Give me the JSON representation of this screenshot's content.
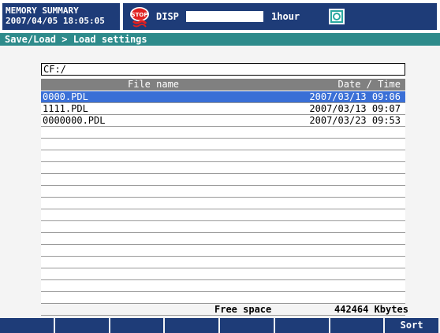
{
  "header": {
    "mode_line1": "MEMORY SUMMARY",
    "mode_line2": "2007/04/05 18:05:05",
    "disp_label": "DISP",
    "time_span": "1hour",
    "stop_icon": "stop-icon",
    "memory_icon": "memory-card-icon"
  },
  "breadcrumb": "Save/Load > Load settings",
  "file_browser": {
    "path": "CF:/",
    "columns": {
      "file_name": "File name",
      "date_time": "Date / Time"
    },
    "rows": [
      {
        "name": "0000.PDL",
        "datetime": "2007/03/13 09:06",
        "selected": true
      },
      {
        "name": "1111.PDL",
        "datetime": "2007/03/13 09:07",
        "selected": false
      },
      {
        "name": "0000000.PDL",
        "datetime": "2007/03/23 09:53",
        "selected": false
      }
    ],
    "empty_row_count": 17
  },
  "footer": {
    "free_space_label": "Free space",
    "free_space_value": "442464 Kbytes"
  },
  "softkeys": [
    "",
    "",
    "",
    "",
    "",
    "",
    "",
    "Sort"
  ],
  "colors": {
    "accent": "#1e3c78",
    "breadcrumb": "#2e8b8b",
    "selection": "#3a6fd6",
    "header": "#808080"
  }
}
